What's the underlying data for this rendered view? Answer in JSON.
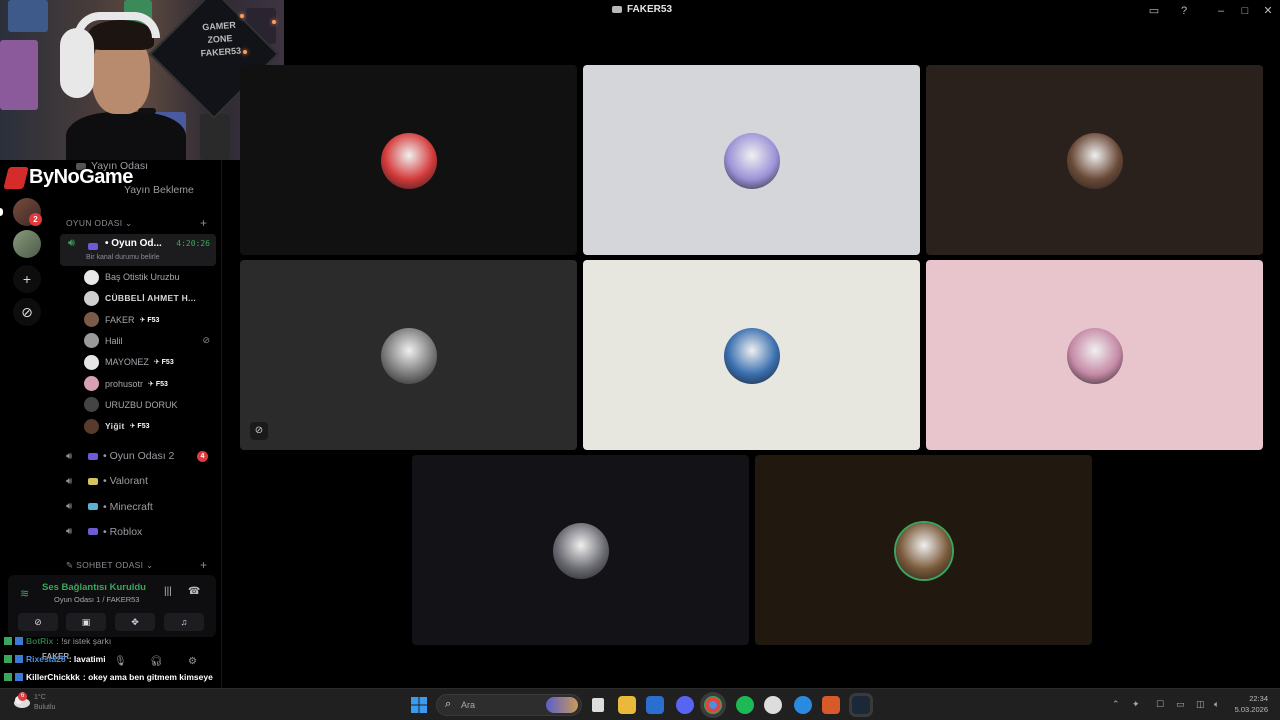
{
  "window": {
    "title": "FAKER53"
  },
  "server_rail": {
    "badge": "2"
  },
  "sidebar": {
    "prev_channels": [
      "Yayın Odası",
      "Yayın Bekleme"
    ],
    "category_game": "OYUN ODASI",
    "active_channel": {
      "name": "• Oyun Od...",
      "timer": "4:20:26",
      "status": "Bir kanal durumu belirle"
    },
    "users": [
      {
        "name": "Baş Otistik Uruzbu",
        "tag": "",
        "color": "#e8e8e8"
      },
      {
        "name": "CÜBBELİ AHMET H...",
        "tag": "",
        "color": "#cfcfcf"
      },
      {
        "name": "FAKER",
        "tag": "F53",
        "color": "#7a5a48"
      },
      {
        "name": "Halil",
        "tag": "",
        "color": "#9a9a9a"
      },
      {
        "name": "MAYONEZ",
        "tag": "F53",
        "color": "#e6e6e6"
      },
      {
        "name": "prohusotr",
        "tag": "F53",
        "color": "#d8a0b0"
      },
      {
        "name": "URUZBU DORUK",
        "tag": "",
        "color": "#444"
      },
      {
        "name": "Yiğit",
        "tag": "F53",
        "color": "#5a3a2a"
      }
    ],
    "channels": [
      {
        "name": "• Oyun Odası 2",
        "badge": "4",
        "emo": "#6d5bd6"
      },
      {
        "name": "• Valorant",
        "badge": "",
        "emo": "#d6c35b"
      },
      {
        "name": "• Minecraft",
        "badge": "",
        "emo": "#5bb0d6"
      },
      {
        "name": "• Roblox",
        "badge": "",
        "emo": "#6d5bd6"
      }
    ],
    "category_chat": "SOHBET ODASI"
  },
  "voice_panel": {
    "connected": "Ses Bağlantısı Kuruldu",
    "location": "Oyun Odası 1 / FAKER53"
  },
  "user_bar": {
    "name": "FAKER",
    "sub": "• FAKER53"
  },
  "brand": {
    "text": "ByNoGame"
  },
  "webcam": {
    "sign_text": "GAMER ZONE FAKER53"
  },
  "chat": [
    {
      "user": "BotRix",
      "msg": ": !sr istek şarkı",
      "color": "#3ba55d"
    },
    {
      "user": "Rixesta28",
      "msg": ": lavatimi",
      "color": "#4a8fe0"
    },
    {
      "user": "KillerChickkk",
      "msg": ": okey ama ben gitmem kimseye",
      "color": "#ffffff"
    }
  ],
  "tiles": [
    {
      "bg": "#111112",
      "avatar": "#d43a3a",
      "muted": false,
      "speaking": false
    },
    {
      "bg": "#d5d6da",
      "avatar": "#9c93d8",
      "muted": false,
      "speaking": false
    },
    {
      "bg": "#2a211c",
      "avatar": "#6b4a38",
      "muted": false,
      "speaking": false
    },
    {
      "bg": "#2b2b2b",
      "avatar": "#7a7a7a",
      "muted": true,
      "speaking": false
    },
    {
      "bg": "#e7e7df",
      "avatar": "#3a6fb0",
      "muted": false,
      "speaking": false
    },
    {
      "bg": "#e8c4cc",
      "avatar": "#c68aa6",
      "muted": false,
      "speaking": false
    },
    {
      "bg": "#131317",
      "avatar": "#6a6a72",
      "muted": false,
      "speaking": false
    },
    {
      "bg": "#21180f",
      "avatar": "#7a5a3a",
      "muted": false,
      "speaking": true
    }
  ],
  "taskbar": {
    "search_placeholder": "Ara",
    "clock_time": "22:34",
    "clock_date": "5.03.2026",
    "weather_temp": "1°C",
    "weather_text": "Bulutlu",
    "weather_badge": "6"
  },
  "colors": {
    "accent_green": "#3ba55d",
    "badge_red": "#e03a3e",
    "background": "#000000"
  }
}
